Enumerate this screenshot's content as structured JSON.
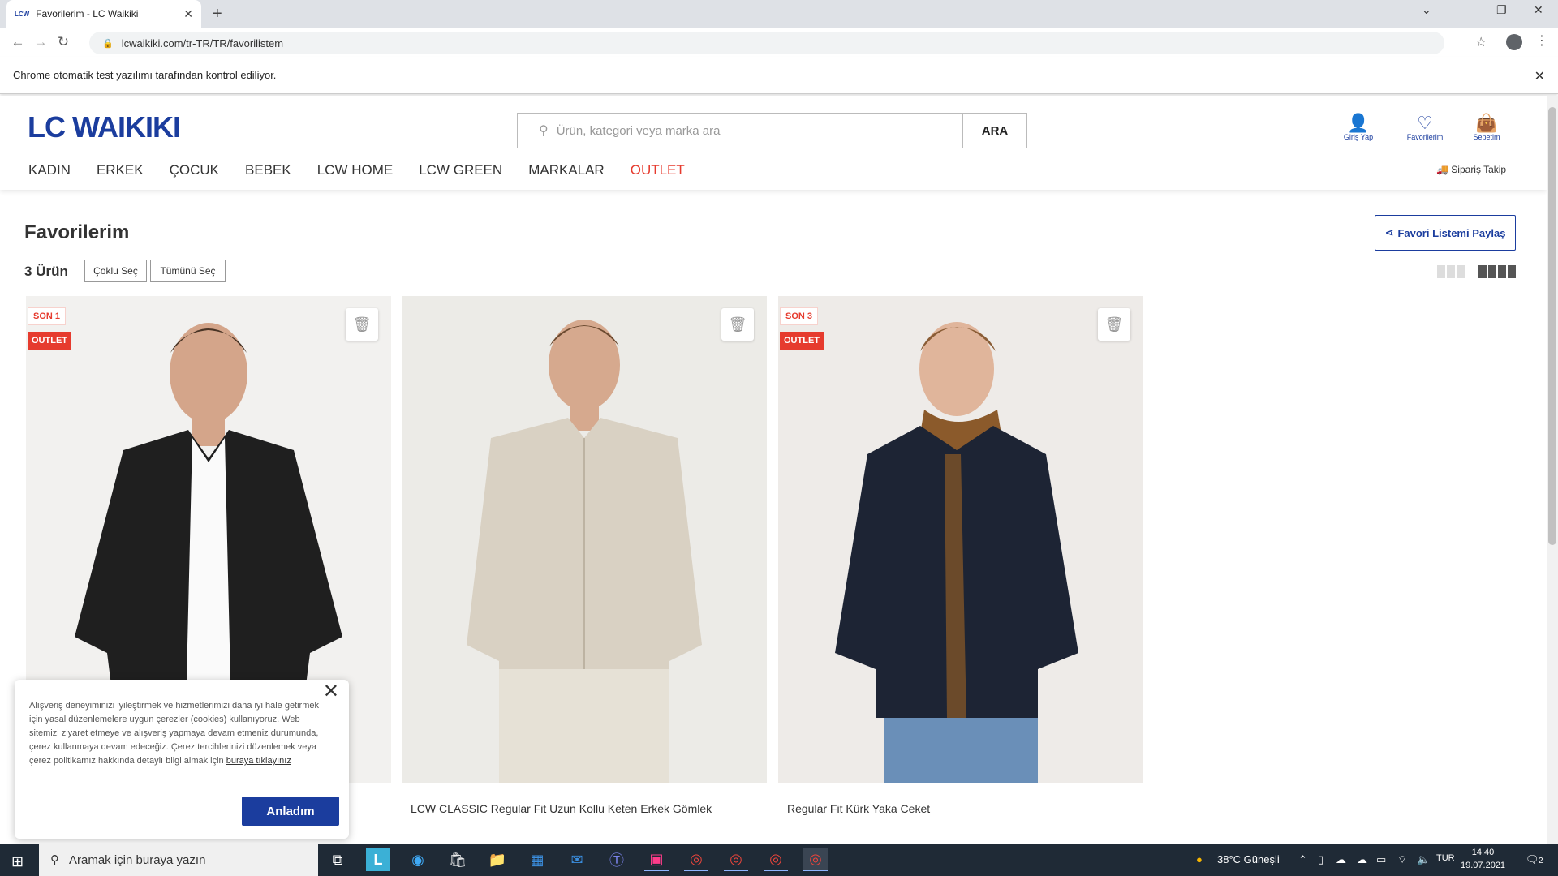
{
  "browser": {
    "tab_favicon": "LCW",
    "tab_title": "Favorilerim - LC Waikiki",
    "url": "lcwaikiki.com/tr-TR/TR/favorilistem",
    "infobar_text": "Chrome otomatik test yazılımı tarafından kontrol ediliyor."
  },
  "header": {
    "logo": "LC WAIKIKI",
    "search_placeholder": "Ürün, kategori veya marka ara",
    "search_button": "ARA",
    "login": "Giriş Yap",
    "favorites": "Favorilerim",
    "cart": "Sepetim",
    "nav": [
      "KADIN",
      "ERKEK",
      "ÇOCUK",
      "BEBEK",
      "LCW HOME",
      "LCW GREEN",
      "MARKALAR",
      "OUTLET"
    ],
    "order_tracking": "Sipariş Takip"
  },
  "main": {
    "title": "Favorilerim",
    "share_button": "Favori Listemi Paylaş",
    "count": "3 Ürün",
    "multi_select": "Çoklu Seç",
    "select_all": "Tümünü Seç",
    "products": [
      {
        "son": "SON 1",
        "outlet": "OUTLET",
        "name": "",
        "colors": {
          "bg": "#f2f1ef",
          "item": "#1f1f1f"
        }
      },
      {
        "son": "",
        "outlet": "",
        "name": "LCW CLASSIC Regular Fit Uzun Kollu Keten Erkek Gömlek",
        "colors": {
          "bg": "#ecebe7",
          "item": "#d9d1c3"
        }
      },
      {
        "son": "SON 3",
        "outlet": "OUTLET",
        "name": "Regular Fit Kürk Yaka Ceket",
        "colors": {
          "bg": "#eeebe8",
          "item": "#1d2434"
        }
      }
    ]
  },
  "cookie": {
    "text": "Alışveriş deneyiminizi iyileştirmek ve hizmetlerimizi daha iyi hale getirmek için yasal düzenlemelere uygun çerezler (cookies) kullanıyoruz. Web sitemizi ziyaret etmeye ve alışveriş yapmaya devam etmeniz durumunda, çerez kullanmaya devam edeceğiz. Çerez tercihlerinizi düzenlemek veya çerez politikamız hakkında detaylı bilgi almak için ",
    "link": "buraya tıklayınız",
    "button": "Anladım"
  },
  "taskbar": {
    "search_placeholder": "Aramak için buraya yazın",
    "weather": "38°C  Güneşli",
    "lang": "TUR",
    "time": "14:40",
    "date": "19.07.2021",
    "notifications": "2"
  },
  "colors": {
    "brand": "#1b3d9e",
    "outlet_red": "#e63b2e"
  }
}
